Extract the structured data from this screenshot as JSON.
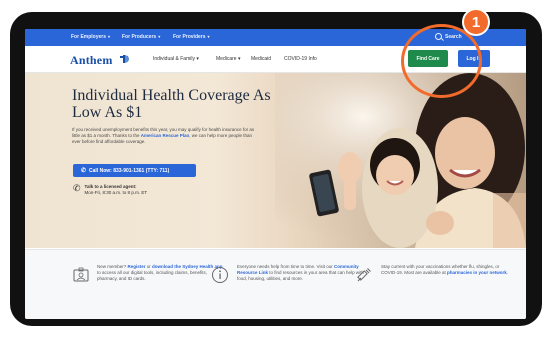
{
  "utility_nav": {
    "items": [
      {
        "label": "For Employers"
      },
      {
        "label": "For Producers"
      },
      {
        "label": "For Providers"
      }
    ],
    "search_label": "Search"
  },
  "header": {
    "logo_text": "Anthem",
    "nav": [
      {
        "label": "Individual & Family"
      },
      {
        "label": "Medicare"
      },
      {
        "label": "Medicaid"
      },
      {
        "label": "COVID-19 Info"
      }
    ],
    "find_care_label": "Find Care",
    "login_label": "Log In"
  },
  "hero": {
    "title": "Individual Health Coverage As Low As $1",
    "desc_before": "If you received unemployment benefits this year, you may qualify for health insurance for as little as $1 a month. Thanks to the ",
    "desc_link": "American Rescue Plan",
    "desc_after": ", we can help more people than ever before find affordable coverage.",
    "call_label": "Call Now: 833-901-1361 (TTY: 711)",
    "agent_title": "Talk to a licensed agent:",
    "agent_hours": "Mon-Fri, 8:30 a.m. to 8 p.m. ET"
  },
  "info_items": [
    {
      "icon": "id-card-icon",
      "before": "New member? ",
      "link1": "Register",
      "middle": " or ",
      "link2": "download the Sydney Health app",
      "after": " to access all our digital tools, including claims, benefits, pharmacy, and ID cards."
    },
    {
      "icon": "info-icon",
      "before": "Everyone needs help from time to time. Visit our ",
      "link1": "Community Resource Link",
      "after": " to find resources in your area that can help with food, housing, utilities, and more."
    },
    {
      "icon": "syringe-icon",
      "before": "Stay current with your vaccinations whether flu, shingles, or COVID-19. Most are available at ",
      "link1": "pharmacies in your network",
      "after": "."
    }
  ],
  "callout": {
    "number": "1",
    "color": "#f26b2c"
  },
  "colors": {
    "brand_blue": "#2b66d8",
    "find_care_green": "#1e8a4c"
  }
}
